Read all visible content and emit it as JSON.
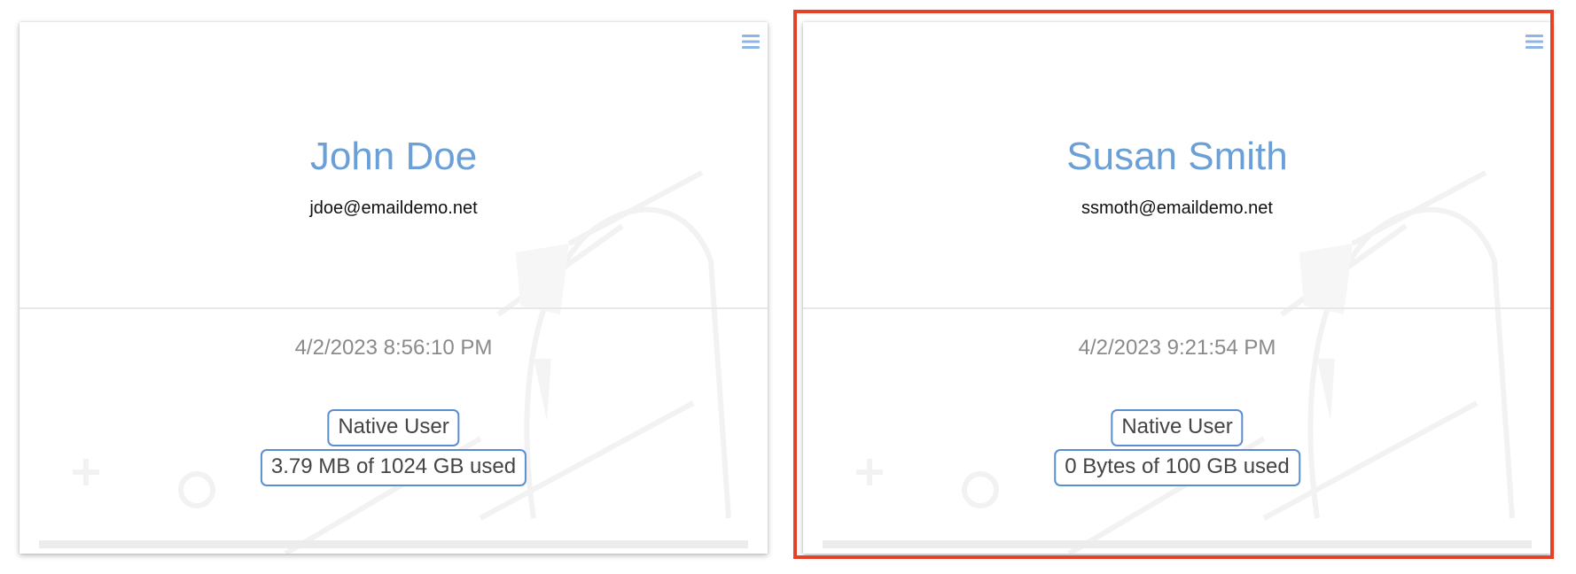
{
  "users": [
    {
      "name": "John Doe",
      "email": "jdoe@emaildemo.net",
      "timestamp": "4/2/2023 8:56:10 PM",
      "user_type": "Native User",
      "storage": "3.79 MB of 1024 GB used"
    },
    {
      "name": "Susan Smith",
      "email": "ssmoth@emaildemo.net",
      "timestamp": "4/2/2023 9:21:54 PM",
      "user_type": "Native User",
      "storage": "0 Bytes of 100 GB used"
    }
  ],
  "icons": {
    "menu": "hamburger-menu-icon"
  },
  "colors": {
    "name": "#6a9fd8",
    "badge_border": "#5b8ed1",
    "selection_border": "#e8412a",
    "menu_icon": "#8fb4e6"
  }
}
